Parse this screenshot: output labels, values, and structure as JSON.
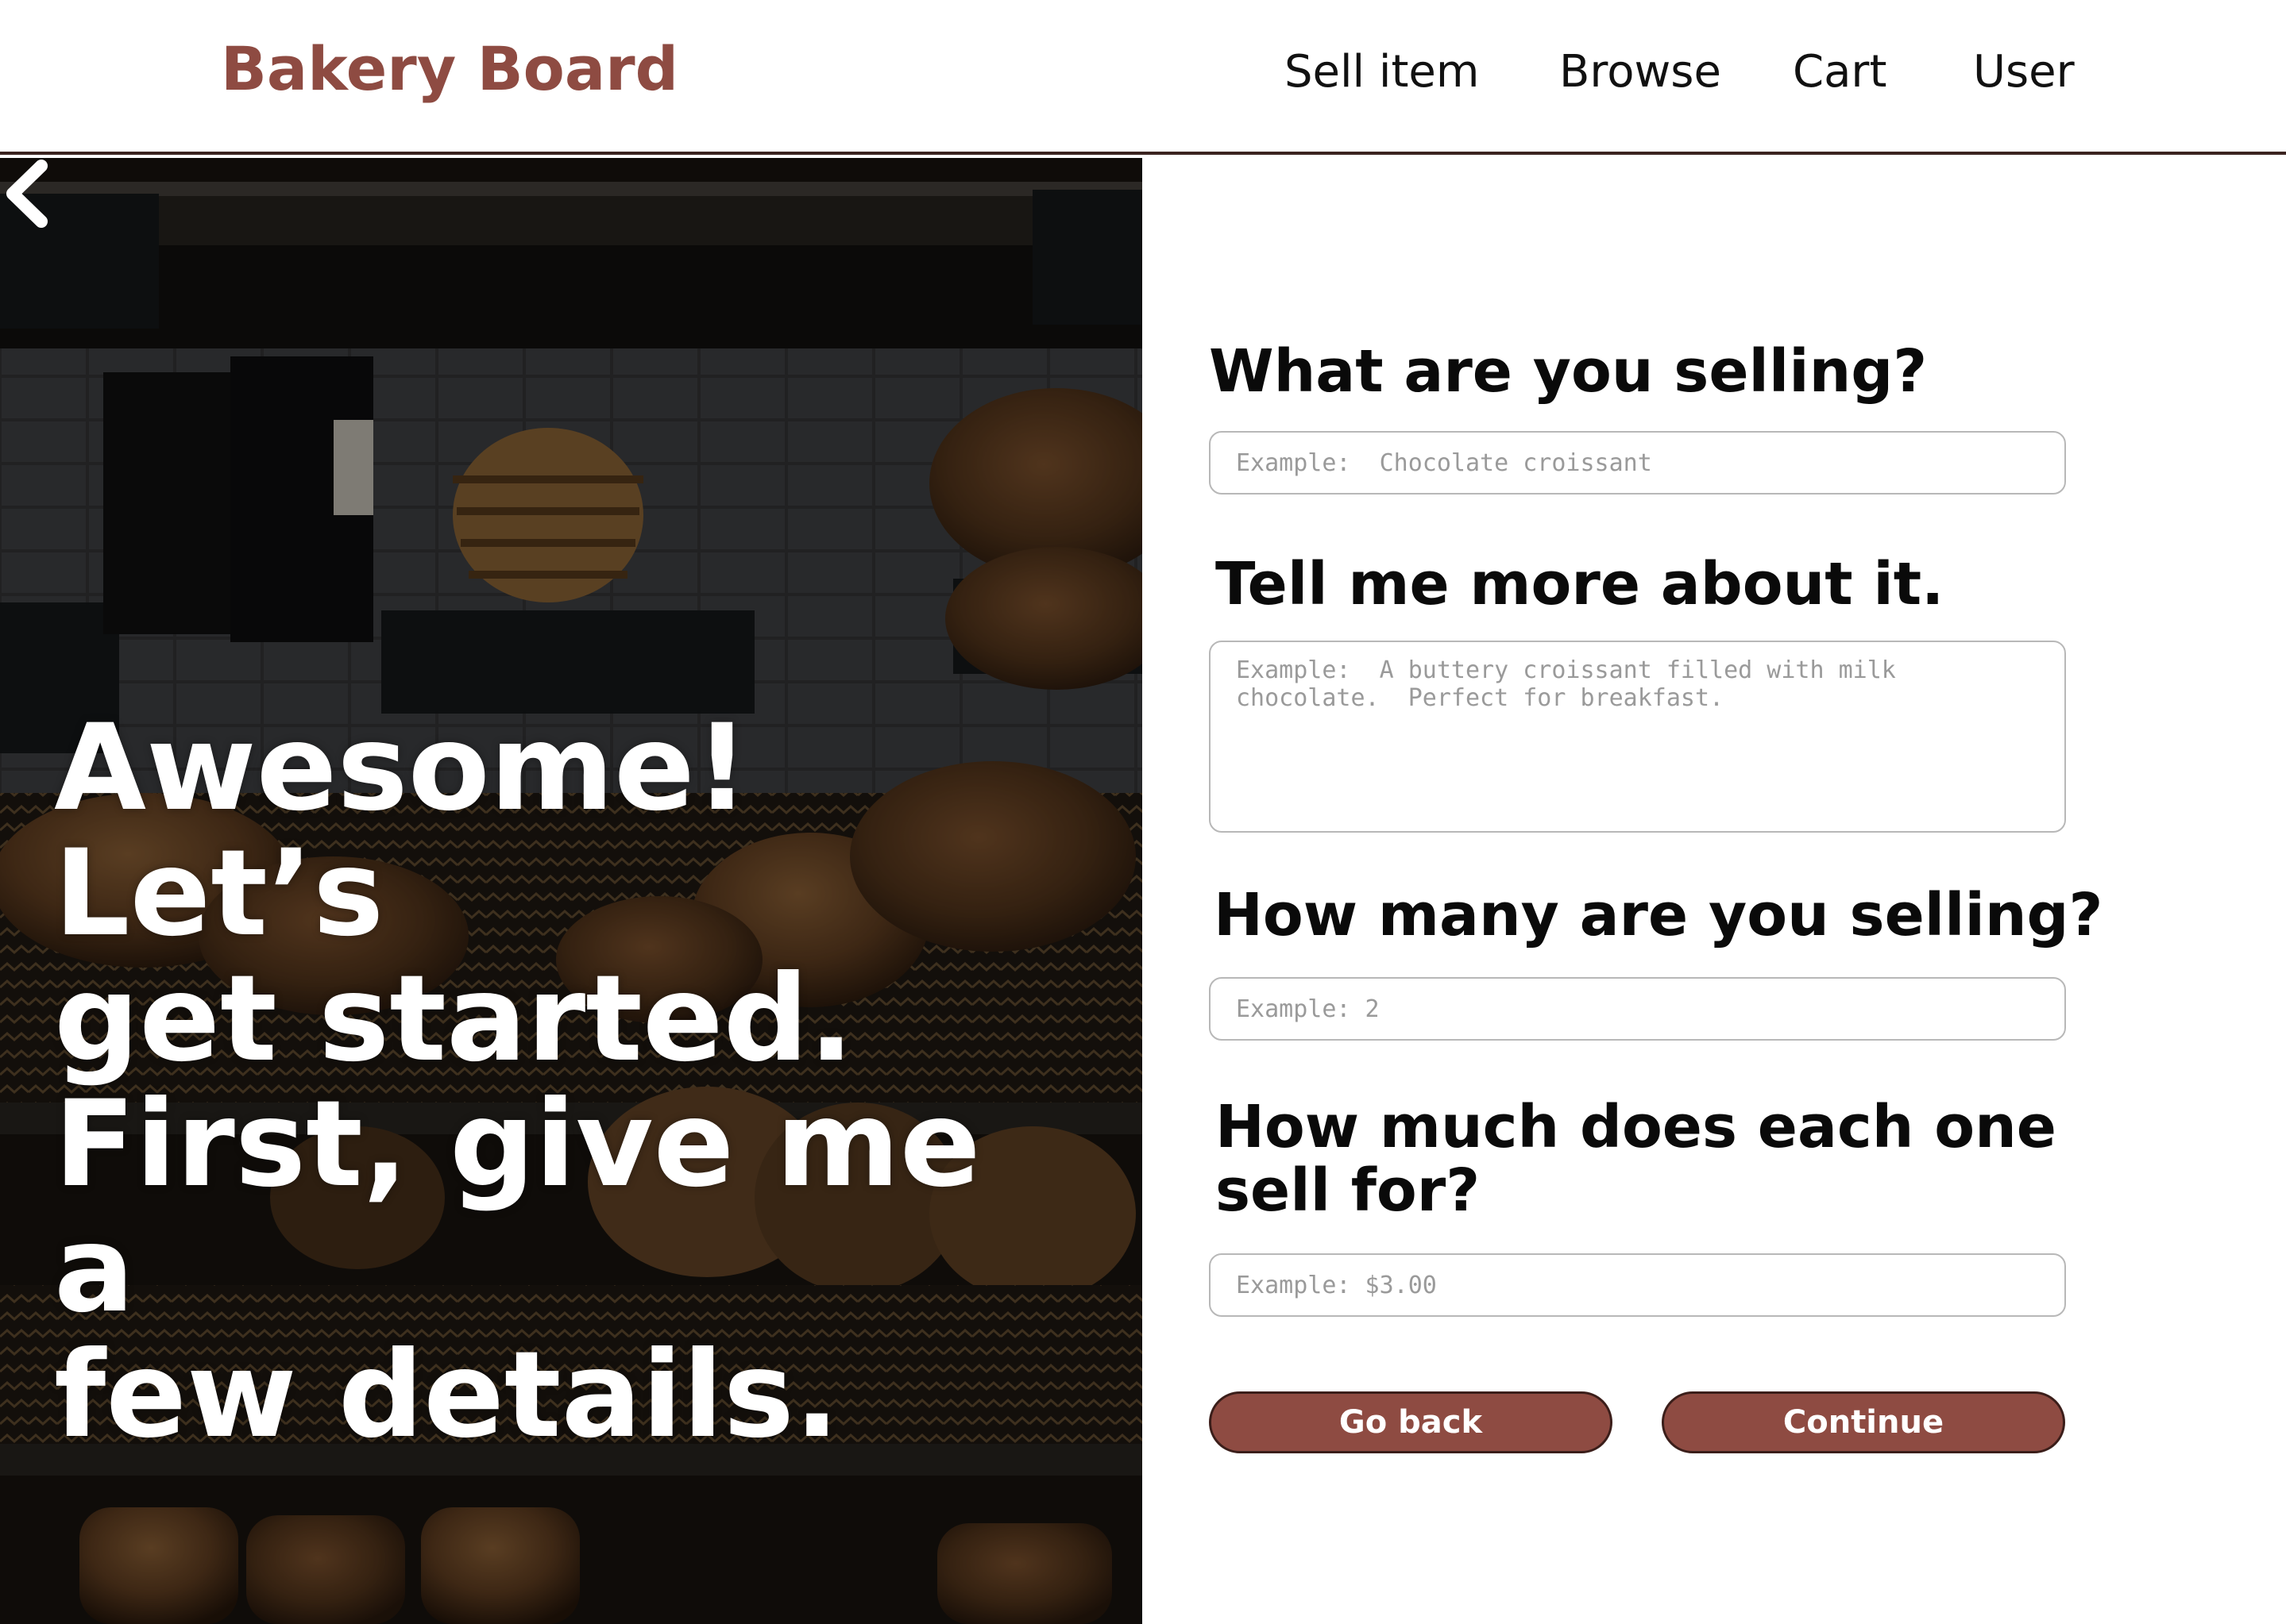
{
  "header": {
    "logo": "Bakery Board",
    "nav": [
      "Sell item",
      "Browse",
      "Cart",
      "User"
    ]
  },
  "hero": {
    "back_icon": "chevron-left-icon",
    "lines": [
      "Awesome!  Let’s",
      "get started.",
      "First, give me a",
      "few details."
    ]
  },
  "form": {
    "q1": {
      "label": "What are you selling?",
      "placeholder": "Example:  Chocolate croissant"
    },
    "q2": {
      "label": "Tell me more about it.",
      "placeholder": "Example:  A buttery croissant filled with milk chocolate.  Perfect for breakfast."
    },
    "q3": {
      "label": "How many are you selling?",
      "placeholder": "Example: 2"
    },
    "q4": {
      "label": "How much does each one sell for?",
      "placeholder": "Example: $3.00"
    },
    "go_back": "Go back",
    "continue": "Continue"
  },
  "colors": {
    "brand": "#8e4b42",
    "border_dark": "#3b2420"
  }
}
